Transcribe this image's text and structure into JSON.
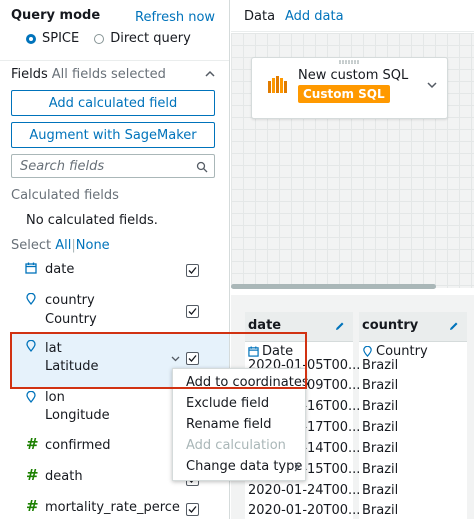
{
  "query_mode": {
    "title": "Query mode",
    "refresh_label": "Refresh now",
    "options": [
      {
        "label": "SPICE",
        "selected": true
      },
      {
        "label": "Direct query",
        "selected": false
      }
    ]
  },
  "fields_panel": {
    "title": "Fields",
    "subtitle": "All fields selected",
    "add_calculated_label": "Add calculated field",
    "augment_label": "Augment with SageMaker",
    "search_placeholder": "Search fields",
    "calculated_title": "Calculated fields",
    "no_calculated_text": "No calculated fields.",
    "select_label": "Select",
    "select_all_label": "All",
    "select_divider": "|",
    "select_none_label": "None",
    "fields": [
      {
        "name": "date",
        "type": "",
        "icon": "calendar-icon",
        "checked": true
      },
      {
        "name": "country",
        "type": "Country",
        "icon": "location-pin-icon",
        "checked": true
      },
      {
        "name": "lat",
        "type": "Latitude",
        "icon": "location-pin-icon",
        "checked": true,
        "highlighted": true
      },
      {
        "name": "lon",
        "type": "Longitude",
        "icon": "location-pin-icon",
        "checked": true
      },
      {
        "name": "confirmed",
        "type": "",
        "icon": "hash-icon",
        "checked": true
      },
      {
        "name": "death",
        "type": "",
        "icon": "hash-icon",
        "checked": true
      },
      {
        "name": "mortality_rate_perce",
        "type": "",
        "icon": "hash-icon",
        "checked": true
      }
    ]
  },
  "tabs": {
    "data_label": "Data",
    "add_data_label": "Add data"
  },
  "datasource_card": {
    "title": "New custom SQL",
    "badge": "Custom SQL"
  },
  "preview": {
    "columns": [
      {
        "header": "date",
        "type_label": "Date",
        "cells": [
          "2020-01-05T00...",
          "2020-01-09T00...",
          "2020-01-16T00...",
          "2020-01-17T00...",
          "2020-01-14T00...",
          "2020-01-15T00...",
          "2020-01-24T00...",
          "2020-01-20T00..."
        ]
      },
      {
        "header": "country",
        "type_label": "Country",
        "cells": [
          "Brazil",
          "Brazil",
          "Brazil",
          "Brazil",
          "Brazil",
          "Brazil",
          "Brazil",
          "Brazil"
        ]
      }
    ]
  },
  "context_menu": {
    "items": [
      {
        "label": "Add to coordinates",
        "disabled": false
      },
      {
        "label": "Exclude field",
        "disabled": false
      },
      {
        "label": "Rename field",
        "disabled": false
      },
      {
        "label": "Add calculation",
        "disabled": true
      },
      {
        "label": "Change data type",
        "disabled": false,
        "submenu": true
      }
    ]
  },
  "colors": {
    "accent": "#0073bb",
    "highlight_bg": "#e6f2fb",
    "callout_border": "#d13212",
    "badge_bg": "#ff9900",
    "measure_icon": "#1d8102"
  }
}
